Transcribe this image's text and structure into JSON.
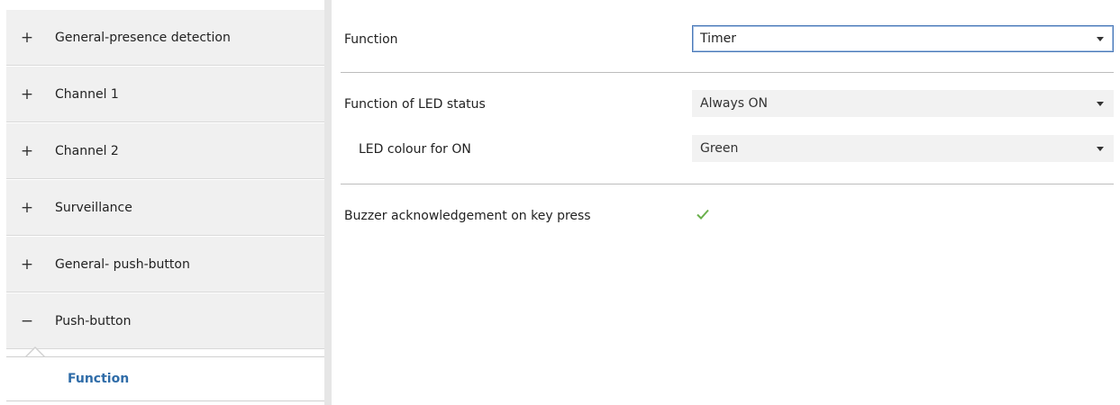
{
  "sidebar": {
    "items": [
      {
        "expander": "+",
        "label": "General-presence detection"
      },
      {
        "expander": "+",
        "label": "Channel 1"
      },
      {
        "expander": "+",
        "label": "Channel 2"
      },
      {
        "expander": "+",
        "label": "Surveillance"
      },
      {
        "expander": "+",
        "label": "General- push-button"
      },
      {
        "expander": "−",
        "label": "Push-button"
      }
    ],
    "selected_child": {
      "label": "Function"
    }
  },
  "main": {
    "function": {
      "label": "Function",
      "value": "Timer"
    },
    "led_status": {
      "label": "Function of LED status",
      "value": "Always ON"
    },
    "led_colour": {
      "label": "LED colour for ON",
      "value": "Green"
    },
    "buzzer": {
      "label": "Buzzer acknowledgement on key press",
      "checked": true,
      "check_color": "#6ab04c"
    }
  },
  "colors": {
    "accent": "#2f6ca8",
    "sidebar_bg": "#f0f0f0",
    "active_border": "#4a79b8"
  }
}
